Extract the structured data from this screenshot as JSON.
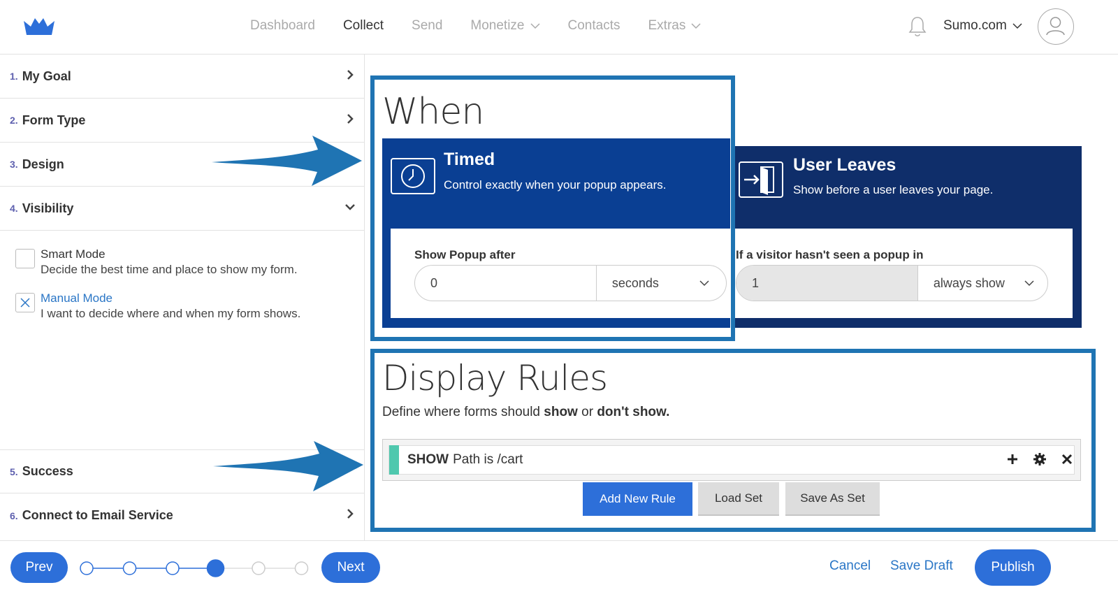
{
  "nav": {
    "items": [
      {
        "label": "Dashboard",
        "active": false,
        "dropdown": false
      },
      {
        "label": "Collect",
        "active": true,
        "dropdown": false
      },
      {
        "label": "Send",
        "active": false,
        "dropdown": false
      },
      {
        "label": "Monetize",
        "active": false,
        "dropdown": true
      },
      {
        "label": "Contacts",
        "active": false,
        "dropdown": false
      },
      {
        "label": "Extras",
        "active": false,
        "dropdown": true
      }
    ],
    "account": "Sumo.com"
  },
  "sidebar": {
    "steps": [
      {
        "num": "1.",
        "label": "My Goal"
      },
      {
        "num": "2.",
        "label": "Form Type"
      },
      {
        "num": "3.",
        "label": "Design"
      },
      {
        "num": "4.",
        "label": "Visibility"
      },
      {
        "num": "5.",
        "label": "Success"
      },
      {
        "num": "6.",
        "label": "Connect to Email Service"
      }
    ],
    "options": [
      {
        "title": "Smart Mode",
        "desc": "Decide the best time and place to show my form.",
        "checked": false
      },
      {
        "title": "Manual Mode",
        "desc": "I want to decide where and when my form shows.",
        "checked": true
      }
    ]
  },
  "when": {
    "title": "When",
    "timed": {
      "title": "Timed",
      "desc": "Control exactly when your popup appears.",
      "field_label": "Show Popup after",
      "value": "0",
      "unit": "seconds"
    },
    "leaves": {
      "title": "User Leaves",
      "desc": "Show before a user leaves your page.",
      "field_label": "If a visitor hasn't seen a popup in",
      "value": "1",
      "unit": "always show"
    }
  },
  "rules": {
    "title": "Display Rules",
    "sub_prefix": "Define where forms should",
    "sub_show": "show",
    "sub_or": "or",
    "sub_dont": "don't show.",
    "rule_show": "SHOW",
    "rule_text": "Path is /cart",
    "add_label": "Add New Rule",
    "load_label": "Load Set",
    "save_label": "Save As Set"
  },
  "footer": {
    "prev": "Prev",
    "next": "Next",
    "cancel": "Cancel",
    "save_draft": "Save Draft",
    "publish": "Publish",
    "progress": {
      "total": 6,
      "current": 4
    }
  },
  "colors": {
    "accent": "#2d6fd9",
    "highlight": "#1f74b3",
    "timed_card": "#0a3f93",
    "leaves_card": "#0f2e6a",
    "rule_bar": "#4fc8ae"
  }
}
